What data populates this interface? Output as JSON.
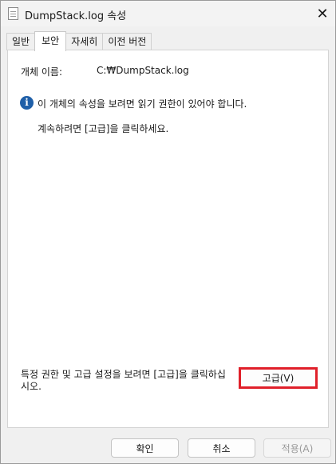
{
  "window": {
    "title": "DumpStack.log 속성",
    "close_glyph": "✕"
  },
  "tabs": [
    {
      "label": "일반",
      "active": false
    },
    {
      "label": "보안",
      "active": true
    },
    {
      "label": "자세히",
      "active": false
    },
    {
      "label": "이전 버전",
      "active": false
    }
  ],
  "security": {
    "object_label": "개체 이름:",
    "object_value": "C:₩DumpStack.log",
    "info_glyph": "i",
    "message_line1": "이 개체의 속성을 보려면 읽기 권한이 있어야 합니다.",
    "message_line2": "계속하려면 [고급]을 클릭하세요.",
    "advanced_text": "특정 권한 및 고급 설정을 보려면 [고급]을 클릭하십시오.",
    "advanced_button": "고급(V)"
  },
  "footer": {
    "ok": "확인",
    "cancel": "취소",
    "apply": "적용(A)"
  },
  "colors": {
    "highlight_border": "#e0202a",
    "info_icon": "#1f5fa8"
  }
}
